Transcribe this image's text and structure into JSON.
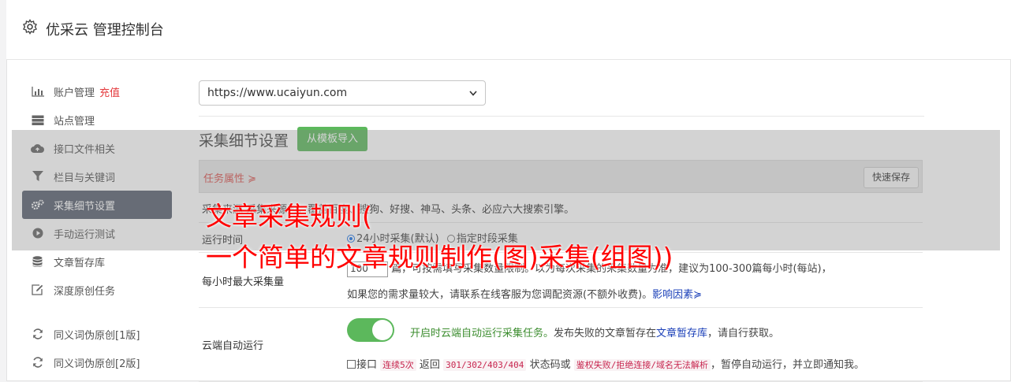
{
  "header": {
    "title": "优采云 管理控制台",
    "icon": "gear-icon"
  },
  "sidebar": {
    "items": [
      {
        "label": "账户管理",
        "extra": "充值",
        "icon": "bar-chart-icon"
      },
      {
        "label": "站点管理",
        "icon": "server-icon"
      },
      {
        "label": "接口文件相关",
        "icon": "cloud-upload-icon"
      },
      {
        "label": "栏目与关键词",
        "icon": "filter-icon"
      },
      {
        "label": "采集细节设置",
        "icon": "cogs-icon",
        "active": true
      },
      {
        "label": "手动运行测试",
        "icon": "play-icon"
      },
      {
        "label": "文章暂存库",
        "icon": "database-icon"
      },
      {
        "label": "深度原创任务",
        "icon": "edit-icon"
      },
      {
        "label": "同义词伪原创[1版]",
        "icon": "refresh-icon"
      },
      {
        "label": "同义词伪原创[2版]",
        "icon": "refresh-icon"
      }
    ]
  },
  "site_select": {
    "value": "https://www.ucaiyun.com"
  },
  "section": {
    "title": "采集细节设置",
    "import_button": "从模板导入",
    "task_attr_label": "任务属性 ≽",
    "quick_save": "快速保存"
  },
  "rows": {
    "source_text": "采集来源  采集来源为：覆盖百度、搜狗、好搜、神马、头条、必应六大搜索引擎。",
    "run_time_label": "运行时间",
    "run_time_opt1": "24小时采集(默认)",
    "run_time_opt2": "指定时段采集",
    "max_label": "每小时最大采集量",
    "max_value": "100",
    "max_line1": "篇，可按需填写采集数量限制。以为每次采集的采集数量为准，建议为100-300篇每小时(每站)，",
    "max_line2": "如果您的需求量较大，请联系在线客服为您调配资源(不额外收费)。",
    "max_link": "影响因素≽",
    "cloud_label": "云端自动运行",
    "cloud_line1_green": "开启时云端自动运行采集任务。",
    "cloud_line1_rest": "发布失败的文章暂存在",
    "cloud_line1_link": "文章暂存库",
    "cloud_line1_end": "，请自行获取。",
    "cloud_line2_a": "接口",
    "cloud_code1": "连续5次",
    "cloud_line2_b": "返回",
    "cloud_code2": "301/302/403/404",
    "cloud_line2_c": "状态码或",
    "cloud_code3": "鉴权失败/拒绝连接/域名无法解析",
    "cloud_line2_d": "，暂停自动运行，并立即通知我。"
  },
  "watermark": {
    "line1": "文章采集规则(",
    "line2": "一个简单的文章规则制作(图)采集(组图))"
  },
  "colors": {
    "active_bg": "#5a6270",
    "import_btn": "#5cb85c",
    "watermark": "#ff0000",
    "toggle_on": "#5cb85c"
  }
}
